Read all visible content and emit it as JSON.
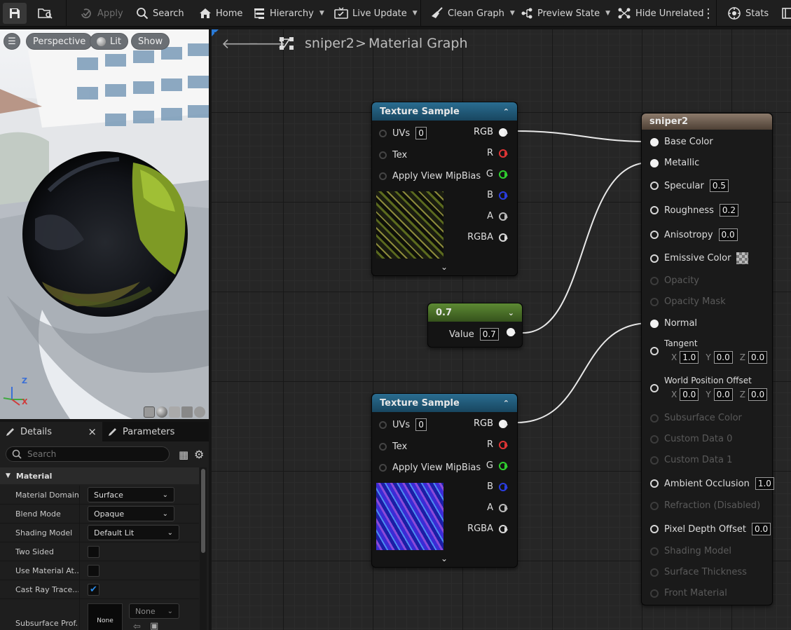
{
  "toolbar": {
    "apply": "Apply",
    "search": "Search",
    "home": "Home",
    "hierarchy": "Hierarchy",
    "live_update": "Live Update",
    "clean_graph": "Clean Graph",
    "preview_state": "Preview State",
    "hide_unrelated": "Hide Unrelated",
    "stats": "Stats"
  },
  "viewport": {
    "perspective": "Perspective",
    "lit": "Lit",
    "show": "Show",
    "axis_z": "Z",
    "axis_x": "X"
  },
  "graph": {
    "breadcrumb_root": "sniper2",
    "breadcrumb_sep": ">",
    "breadcrumb_current": "Material Graph"
  },
  "tex1": {
    "title": "Texture Sample",
    "uvs_label": "UVs",
    "uvs_value": "0",
    "tex": "Tex",
    "mip": "Apply View MipBias",
    "out_rgb": "RGB",
    "out_r": "R",
    "out_g": "G",
    "out_b": "B",
    "out_a": "A",
    "out_rgba": "RGBA"
  },
  "const": {
    "title": "0.7",
    "value_label": "Value",
    "value": "0.7"
  },
  "tex2": {
    "title": "Texture Sample",
    "uvs_label": "UVs",
    "uvs_value": "0",
    "tex": "Tex",
    "mip": "Apply View MipBias",
    "out_rgb": "RGB",
    "out_r": "R",
    "out_g": "G",
    "out_b": "B",
    "out_a": "A",
    "out_rgba": "RGBA"
  },
  "material": {
    "title": "sniper2",
    "base_color": "Base Color",
    "metallic": "Metallic",
    "specular": "Specular",
    "specular_val": "0.5",
    "roughness": "Roughness",
    "roughness_val": "0.2",
    "anisotropy": "Anisotropy",
    "anisotropy_val": "0.0",
    "emissive": "Emissive Color",
    "opacity": "Opacity",
    "opacity_mask": "Opacity Mask",
    "normal": "Normal",
    "tangent": "Tangent",
    "tangent_x": "1.0",
    "tangent_y": "0.0",
    "tangent_z": "0.0",
    "wpo": "World Position Offset",
    "wpo_x": "0.0",
    "wpo_y": "0.0",
    "wpo_z": "0.0",
    "x": "X",
    "y": "Y",
    "z": "Z",
    "subsurface": "Subsurface Color",
    "custom0": "Custom Data 0",
    "custom1": "Custom Data 1",
    "ao": "Ambient Occlusion",
    "ao_val": "1.0",
    "refraction": "Refraction (Disabled)",
    "pdo": "Pixel Depth Offset",
    "pdo_val": "0.0",
    "shading_model": "Shading Model",
    "surface_thickness": "Surface Thickness",
    "front_material": "Front Material"
  },
  "details": {
    "tab_details": "Details",
    "tab_close": "×",
    "tab_parameters": "Parameters",
    "search_placeholder": "Search",
    "section": "Material",
    "rows": [
      {
        "label": "Material Domain",
        "value": "Surface"
      },
      {
        "label": "Blend Mode",
        "value": "Opaque"
      },
      {
        "label": "Shading Model",
        "value": "Default Lit"
      },
      {
        "label": "Two Sided",
        "value": ""
      },
      {
        "label": "Use Material At...",
        "value": ""
      },
      {
        "label": "Cast Ray Trace...",
        "value": ""
      },
      {
        "label": "Subsurface Prof...",
        "value": "None"
      }
    ],
    "subsurface_dropdown": "None"
  }
}
